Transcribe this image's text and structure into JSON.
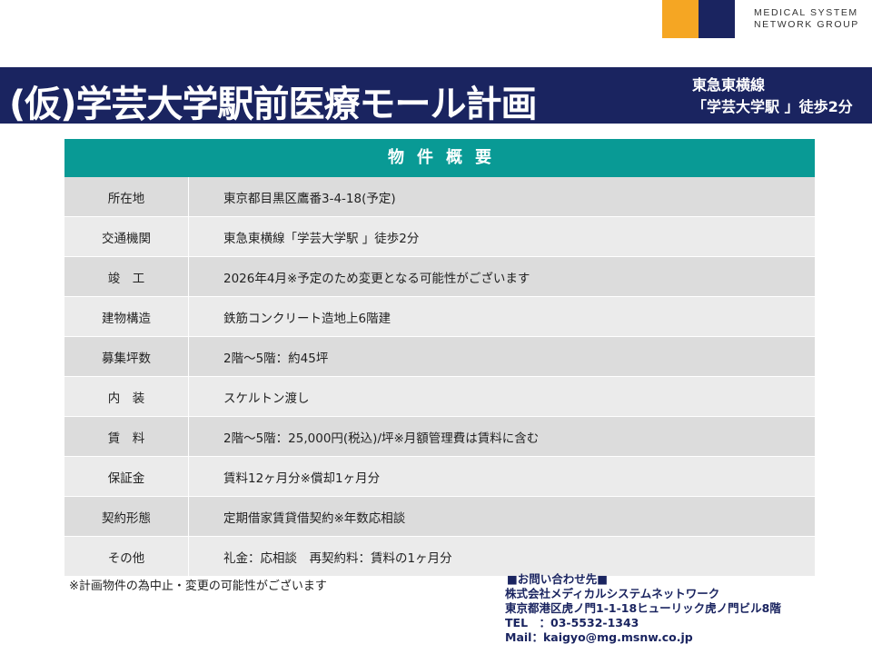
{
  "logo": {
    "line1": "MEDICAL SYSTEM",
    "line2": "NETWORK GROUP",
    "colors": {
      "orange": "#f5a623",
      "navy": "#1a2460"
    }
  },
  "header": {
    "title": "(仮)学芸大学駅前医療モール計画",
    "access_line1": "東急東横線",
    "access_line2": "「学芸大学駅 」徒歩2分"
  },
  "table": {
    "heading": "物件概要",
    "rows": [
      {
        "label": "所在地",
        "value": "東京都目黒区鷹番3-4-18(予定)"
      },
      {
        "label": "交通機関",
        "value": "東急東横線「学芸大学駅 」徒歩2分"
      },
      {
        "label": "竣　工",
        "value": "2026年4月※予定のため変更となる可能性がございます"
      },
      {
        "label": "建物構造",
        "value": "鉄筋コンクリート造地上6階建"
      },
      {
        "label": "募集坪数",
        "value": "2階～5階：約45坪"
      },
      {
        "label": "内　装",
        "value": "スケルトン渡し"
      },
      {
        "label": "賃　料",
        "value": "2階～5階：25,000円(税込)/坪※月額管理費は賃料に含む"
      },
      {
        "label": "保証金",
        "value": "賃料12ヶ月分※償却1ヶ月分"
      },
      {
        "label": "契約形態",
        "value": "定期借家賃貸借契約※年数応相談"
      },
      {
        "label": "その他",
        "value": "礼金：応相談　再契約料：賃料の1ヶ月分"
      }
    ]
  },
  "note": "※計画物件の為中止・変更の可能性がございます",
  "contact": {
    "heading": "■お問い合わせ先■",
    "company": "株式会社メディカルシステムネットワーク",
    "address": "東京都港区虎ノ門1-1-18ヒューリック虎ノ門ビル8階",
    "tel": "TEL　：03-5532-1343",
    "mail": "Mail：kaigyo@mg.msnw.co.jp"
  }
}
